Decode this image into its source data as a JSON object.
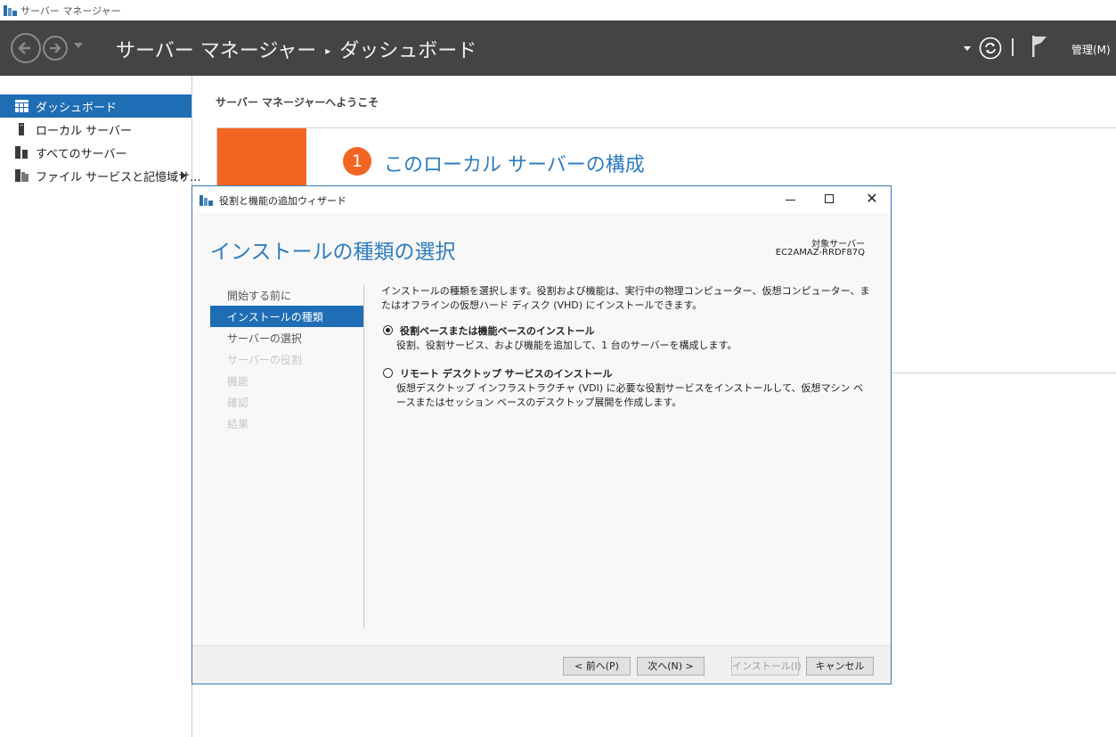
{
  "window": {
    "title": "サーバー マネージャー"
  },
  "header": {
    "breadcrumb_root": "サーバー マネージャー",
    "breadcrumb_separator": "▸",
    "breadcrumb_current": "ダッシュボード",
    "manage_menu": "管理(M)"
  },
  "sidebar": {
    "items": [
      {
        "label": "ダッシュボード",
        "icon": "dashboard-icon"
      },
      {
        "label": "ローカル サーバー",
        "icon": "server-icon"
      },
      {
        "label": "すべてのサーバー",
        "icon": "servers-icon"
      },
      {
        "label": "ファイル サービスと記憶域サ...",
        "icon": "file-storage-icon"
      }
    ]
  },
  "main": {
    "welcome": "サーバー マネージャーへようこそ",
    "step_number": "1",
    "step_title": "このローカル サーバーの構成"
  },
  "dialog": {
    "title": "役割と機能の追加ウィザード",
    "heading": "インストールの種類の選択",
    "target_label": "対象サーバー",
    "target_value": "EC2AMAZ-RRDF87Q",
    "steps": [
      {
        "label": "開始する前に",
        "state": "normal"
      },
      {
        "label": "インストールの種類",
        "state": "current"
      },
      {
        "label": "サーバーの選択",
        "state": "normal"
      },
      {
        "label": "サーバーの役割",
        "state": "disabled"
      },
      {
        "label": "機能",
        "state": "disabled"
      },
      {
        "label": "確認",
        "state": "disabled"
      },
      {
        "label": "結果",
        "state": "disabled"
      }
    ],
    "description": "インストールの種類を選択します。役割および機能は、実行中の物理コンピューター、仮想コンピューター、またはオフラインの仮想ハード ディスク (VHD) にインストールできます。",
    "options": [
      {
        "title": "役割ベースまたは機能ベースのインストール",
        "description": "役割、役割サービス、および機能を追加して、1 台のサーバーを構成します。",
        "checked": true
      },
      {
        "title": "リモート デスクトップ サービスのインストール",
        "description": "仮想デスクトップ インフラストラクチャ (VDI) に必要な役割サービスをインストールして、仮想マシン ベースまたはセッション ベースのデスクトップ展開を作成します。",
        "checked": false
      }
    ],
    "buttons": {
      "previous": "< 前へ(P)",
      "next": "次へ(N) >",
      "install": "インストール(I)",
      "cancel": "キャンセル"
    }
  },
  "colors": {
    "header_bg": "#444444",
    "accent_blue": "#1e6db5",
    "heading_blue": "#2f7cbf",
    "orange": "#f26522"
  }
}
